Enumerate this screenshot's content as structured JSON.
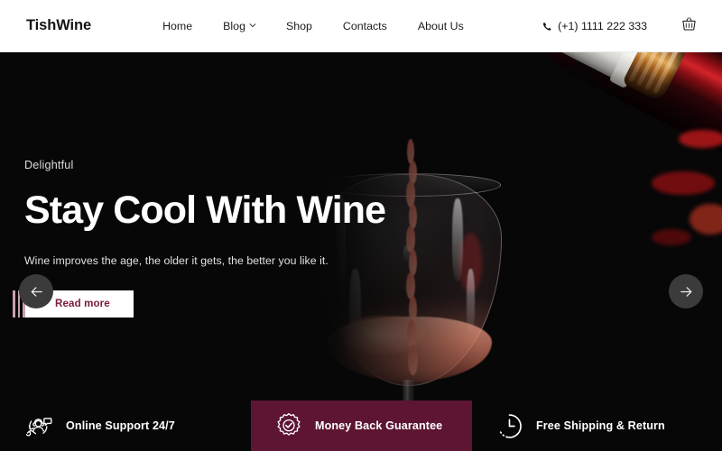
{
  "header": {
    "brand": "TishWine",
    "nav": [
      {
        "label": "Home",
        "has_dropdown": false,
        "icon": ""
      },
      {
        "label": "Blog",
        "has_dropdown": true,
        "icon": "chevron-down-icon"
      },
      {
        "label": "Shop",
        "has_dropdown": false,
        "icon": ""
      },
      {
        "label": "Contacts",
        "has_dropdown": false,
        "icon": ""
      },
      {
        "label": "About Us",
        "has_dropdown": false,
        "icon": ""
      }
    ],
    "phone": "(+1) 1111 222 333",
    "phone_icon": "phone-icon",
    "cart_icon": "shopping-basket-icon"
  },
  "hero": {
    "eyebrow": "Delightful",
    "title": "Stay Cool With Wine",
    "subtitle": "Wine improves the age, the older it gets, the better you like it.",
    "cta_label": "Read more",
    "prev_icon": "arrow-left-icon",
    "next_icon": "arrow-right-icon",
    "background_color": "#070707",
    "cta_text_color": "#7a1b40"
  },
  "features": [
    {
      "label": "Online Support 24/7",
      "icon": "customer-support-icon",
      "background": "#0b0b0b"
    },
    {
      "label": "Money Back Guarantee",
      "icon": "guarantee-badge-icon",
      "background": "#5d1533"
    },
    {
      "label": "Free Shipping & Return",
      "icon": "clock-icon",
      "background": "#0b0b0b"
    }
  ]
}
